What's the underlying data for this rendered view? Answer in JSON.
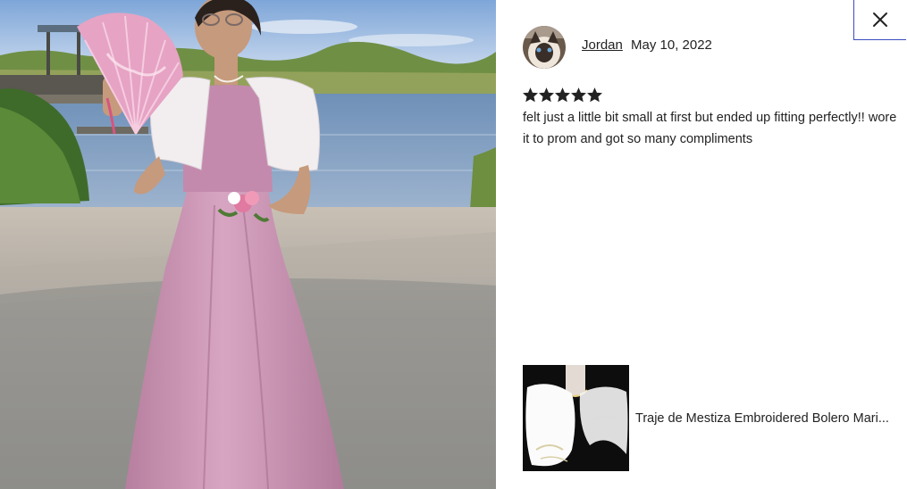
{
  "review": {
    "reviewer_name": "Jordan",
    "date": "May 10, 2022",
    "rating": 5,
    "rating_max": 5,
    "text": "felt just a little bit small at first but ended up fitting perfectly!! wore it to prom and got so many compliments"
  },
  "product": {
    "title": "Traje de Mestiza Embroidered Bolero Mari..."
  },
  "icons": {
    "close": "close-icon",
    "star": "star-icon"
  },
  "colors": {
    "text": "#222222",
    "star": "#222222",
    "close_border": "#3b4cc0"
  }
}
